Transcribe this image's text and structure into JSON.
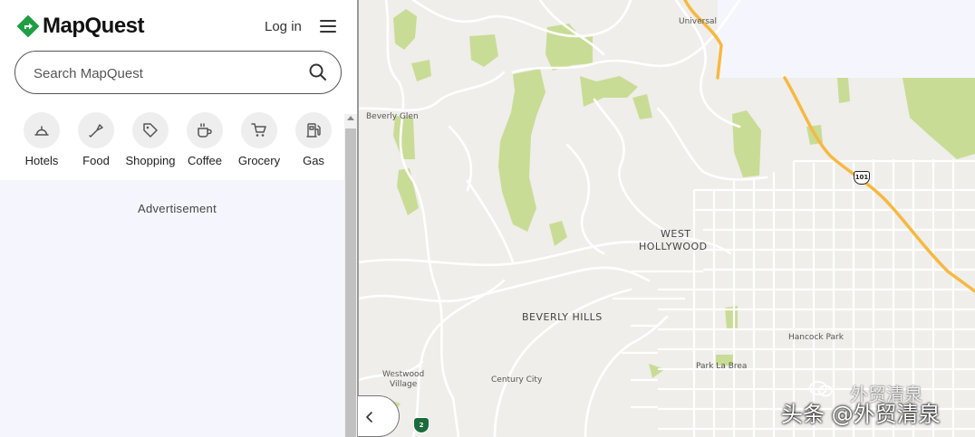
{
  "header": {
    "brand": "MapQuest",
    "login_label": "Log in",
    "menu_icon": "hamburger-menu-icon"
  },
  "search": {
    "placeholder": "Search MapQuest",
    "icon": "search-icon"
  },
  "categories": [
    {
      "label": "Hotels",
      "icon": "bell-icon"
    },
    {
      "label": "Food",
      "icon": "utensils-icon"
    },
    {
      "label": "Shopping",
      "icon": "tag-icon"
    },
    {
      "label": "Coffee",
      "icon": "coffee-cup-icon"
    },
    {
      "label": "Grocery",
      "icon": "cart-icon"
    },
    {
      "label": "Gas",
      "icon": "gas-pump-icon"
    }
  ],
  "ad": {
    "label": "Advertisement"
  },
  "map": {
    "labels": {
      "universal": "Universal",
      "beverly_glen": "Beverly Glen",
      "west_hollywood_1": "WEST",
      "west_hollywood_2": "HOLLYWOOD",
      "beverly_hills": "BEVERLY HILLS",
      "hancock_park": "Hancock Park",
      "park_la_brea": "Park La Brea",
      "westwood_1": "Westwood",
      "westwood_2": "Village",
      "century_city": "Century City"
    },
    "shields": {
      "us_101": "101",
      "ca_2": "2"
    },
    "colors": {
      "land": "#efeeea",
      "park": "#c9dc96",
      "highway": "#f5b942",
      "road": "#ffffff"
    }
  },
  "watermark": {
    "main": "头条 @外贸清泉",
    "secondary": "外贸清泉"
  },
  "colors": {
    "brand_green": "#1f9e44",
    "panel_bg": "#f5f6fd"
  }
}
